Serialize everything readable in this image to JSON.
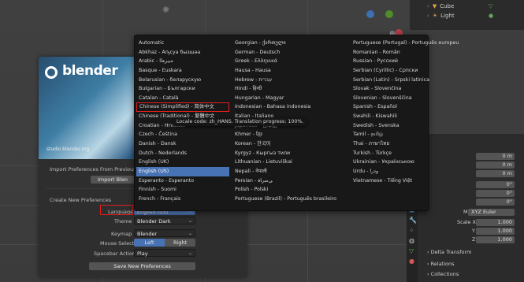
{
  "outliner": {
    "items": [
      {
        "label": "Cube"
      },
      {
        "label": "Light"
      }
    ]
  },
  "splash": {
    "logo_text": "blender",
    "credit": "studio.blender.org",
    "import_heading": "Import Preferences From Previous Ve",
    "import_button": "Import Blen",
    "new_prefs_heading": "Create New Preferences",
    "language_label": "Language",
    "language_value": "English (US)",
    "theme_label": "Theme",
    "theme_value": "Blender Dark",
    "keymap_label": "Keymap",
    "keymap_value": "Blender",
    "mouse_select_label": "Mouse Select",
    "mouse_left": "Left",
    "mouse_right": "Right",
    "spacebar_label": "Spacebar Action",
    "spacebar_value": "Play",
    "save_button": "Save New Preferences"
  },
  "language_menu": {
    "tooltip": "Locale code: zh_HANS. Translation progress: 100%.",
    "columns": [
      [
        "Automatic",
        "Abkhaz - Аҧсуа бызшәа",
        "Arabic - ﺔﻴﺑﺮﻌﻟﺍ",
        "Basque - Euskara",
        "Belarusian - беларускую",
        "Bulgarian - Български",
        "Catalan - Català",
        "Chinese (Simplified) - 简体中文",
        "Chinese (Traditional) - 繁體中文",
        "Croatian - Hrvatski",
        "Czech - Čeština",
        "Danish - Dansk",
        "Dutch - Nederlands",
        "English (UK)",
        "English (US)",
        "Esperanto - Esperanto",
        "Finnish - Suomi",
        "French - Français"
      ],
      [
        "Georgian - ქართული",
        "German - Deutsch",
        "Greek - Ελληνικά",
        "Hausa - Hausa",
        "Hebrew - עברית",
        "Hindi - हिन्दी",
        "Hungarian - Magyar",
        "Indonesian - Bahasa indonesia",
        "Italian - Italiano",
        "Japanese - 日本語",
        "Khmer - ខ្មែរ",
        "Korean - 한국어",
        "Kyrgyz - Кыргыз тили",
        "Lithuanian - Lietuviškai",
        "Nepali - नेपाली",
        "Persian - ﯽﺳﺭﺎﻓ",
        "Polish - Polski",
        "Portuguese (Brazil) - Português brasileiro"
      ],
      [
        "Portuguese (Portugal) - Português europeu",
        "Romanian - Român",
        "Russian - Русский",
        "Serbian (Cyrillic) - Српски",
        "Serbian (Latin) - Srpski latinica",
        "Slovak - Slovenčina",
        "Slovenian - Slovenščina",
        "Spanish - Español",
        "Swahili - Kiswahili",
        "Swedish - Svenska",
        "Tamil - தமிழ்",
        "Thai - ภาษาไทย",
        "Turkish - Türkçe",
        "Ukrainian - Українською",
        "Urdu - ﻭﺩﺭﺍ",
        "Vietnamese - Tiếng Việt"
      ]
    ]
  },
  "properties": {
    "fields_m": [
      "0 m",
      "0 m",
      "0 m"
    ],
    "fields_deg": [
      "0°",
      "0°",
      "0°"
    ],
    "mode_label": "Mode",
    "mode_value": "XYZ Euler",
    "scale_x_label": "Scale X",
    "scale_y_label": "Y",
    "scale_z_label": "Z",
    "scale_values": [
      "1.000",
      "1.000",
      "1.000"
    ],
    "delta_transform": "Delta Transform",
    "relations": "Relations",
    "collections": "Collections"
  },
  "colors": {
    "selection_blue": "#4772b3",
    "highlight_red": "#e21d1d"
  }
}
